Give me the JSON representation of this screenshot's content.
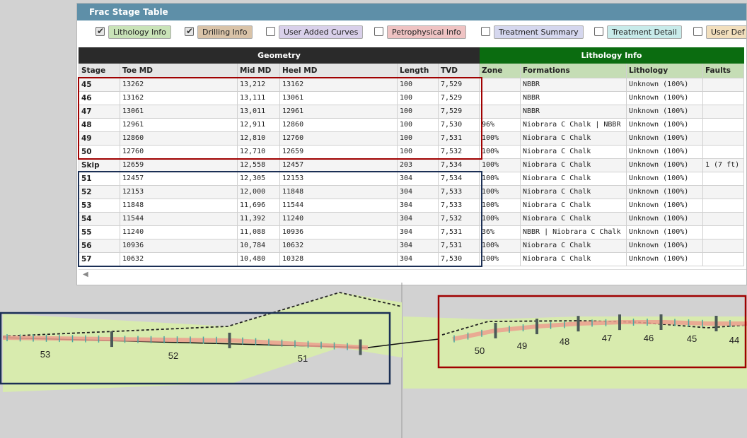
{
  "panel": {
    "title": "Frac Stage Table"
  },
  "legend": [
    {
      "label": "Lithology Info",
      "checked": true,
      "color": "#c9e3b8"
    },
    {
      "label": "Drilling Info",
      "checked": true,
      "color": "#d9c3a8"
    },
    {
      "label": "User Added Curves",
      "checked": false,
      "color": "#d9d0ea"
    },
    {
      "label": "Petrophysical Info",
      "checked": false,
      "color": "#efc3c3"
    },
    {
      "label": "Treatment Summary",
      "checked": false,
      "color": "#d5d7ee"
    },
    {
      "label": "Treatment Detail",
      "checked": false,
      "color": "#c8ebea"
    },
    {
      "label": "User Def",
      "checked": false,
      "color": "#f2dfbd"
    }
  ],
  "table": {
    "group_headers": {
      "geometry": "Geometry",
      "lithology": "Lithology Info"
    },
    "columns": [
      "Stage",
      "Toe MD",
      "Mid MD",
      "Heel MD",
      "Length",
      "TVD",
      "Zone",
      "Formations",
      "Lithology",
      "Faults"
    ],
    "rows": [
      [
        "45",
        "13262",
        "13,212",
        "13162",
        "100",
        "7,529",
        "",
        "NBBR",
        "Unknown (100%)",
        ""
      ],
      [
        "46",
        "13162",
        "13,111",
        "13061",
        "100",
        "7,529",
        "",
        "NBBR",
        "Unknown (100%)",
        ""
      ],
      [
        "47",
        "13061",
        "13,011",
        "12961",
        "100",
        "7,529",
        "",
        "NBBR",
        "Unknown (100%)",
        ""
      ],
      [
        "48",
        "12961",
        "12,911",
        "12860",
        "100",
        "7,530",
        "96%",
        "Niobrara C Chalk | NBBR",
        "Unknown (100%)",
        ""
      ],
      [
        "49",
        "12860",
        "12,810",
        "12760",
        "100",
        "7,531",
        "100%",
        "Niobrara C Chalk",
        "Unknown (100%)",
        ""
      ],
      [
        "50",
        "12760",
        "12,710",
        "12659",
        "100",
        "7,532",
        "100%",
        "Niobrara C Chalk",
        "Unknown (100%)",
        ""
      ],
      [
        "Skip",
        "12659",
        "12,558",
        "12457",
        "203",
        "7,534",
        "100%",
        "Niobrara C Chalk",
        "Unknown (100%)",
        "1 (7 ft)"
      ],
      [
        "51",
        "12457",
        "12,305",
        "12153",
        "304",
        "7,534",
        "100%",
        "Niobrara C Chalk",
        "Unknown (100%)",
        ""
      ],
      [
        "52",
        "12153",
        "12,000",
        "11848",
        "304",
        "7,533",
        "100%",
        "Niobrara C Chalk",
        "Unknown (100%)",
        ""
      ],
      [
        "53",
        "11848",
        "11,696",
        "11544",
        "304",
        "7,533",
        "100%",
        "Niobrara C Chalk",
        "Unknown (100%)",
        ""
      ],
      [
        "54",
        "11544",
        "11,392",
        "11240",
        "304",
        "7,532",
        "100%",
        "Niobrara C Chalk",
        "Unknown (100%)",
        ""
      ],
      [
        "55",
        "11240",
        "11,088",
        "10936",
        "304",
        "7,531",
        "36%",
        "NBBR | Niobrara C Chalk",
        "Unknown (100%)",
        ""
      ],
      [
        "56",
        "10936",
        "10,784",
        "10632",
        "304",
        "7,531",
        "100%",
        "Niobrara C Chalk",
        "Unknown (100%)",
        ""
      ],
      [
        "57",
        "10632",
        "10,480",
        "10328",
        "304",
        "7,530",
        "100%",
        "Niobrara C Chalk",
        "Unknown (100%)",
        ""
      ]
    ]
  },
  "wellbore": {
    "stage_labels": [
      "53",
      "52",
      "51",
      "50",
      "49",
      "48",
      "47",
      "46",
      "45",
      "44"
    ]
  },
  "colors": {
    "header_bar": "#5e8fa8",
    "geometry_header": "#2a2a2a",
    "lithology_header": "#0b6c10",
    "highlight_red": "#a00000",
    "highlight_blue": "#1b2f55",
    "formation_fill": "#d8ebae",
    "wellbore_track": "#ec9f8e",
    "stage_tick": "#4aa5a0"
  }
}
